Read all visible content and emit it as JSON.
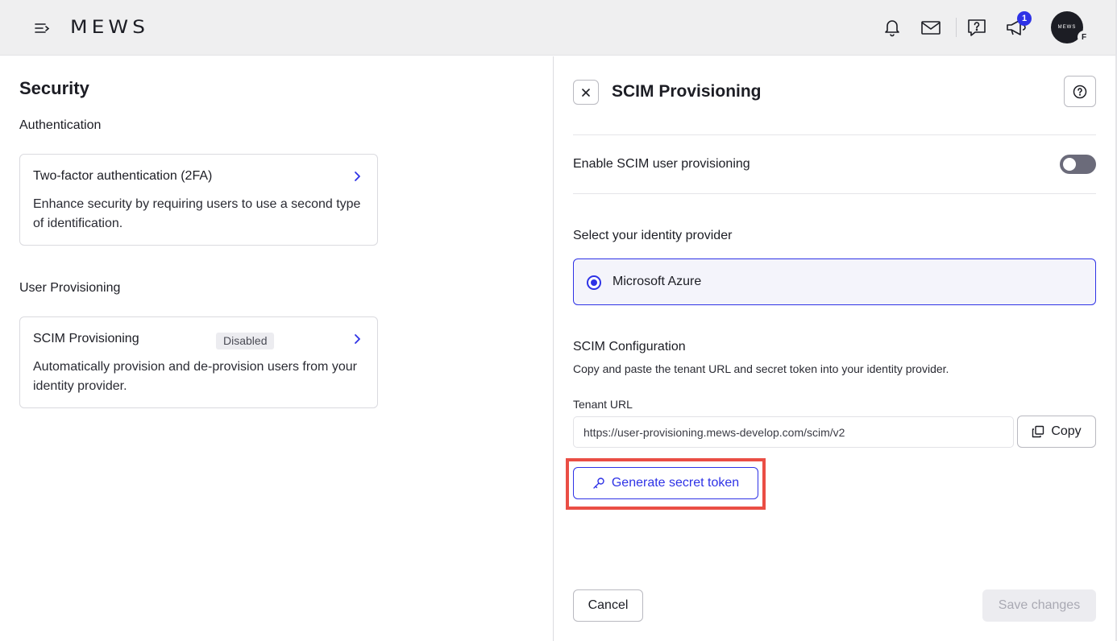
{
  "topbar": {
    "logo": "MEWS",
    "notification_count": "1",
    "avatar_text": "MEWS",
    "avatar_initial": "F",
    "icons": [
      "menu-icon",
      "bell-icon",
      "mail-icon",
      "help-chat-icon",
      "megaphone-icon"
    ]
  },
  "left": {
    "title": "Security",
    "authentication_section": "Authentication",
    "provisioning_section": "User Provisioning",
    "cards": [
      {
        "title": "Two-factor authentication (2FA)",
        "description": "Enhance security by requiring users to use a second type of identification."
      },
      {
        "title": "SCIM Provisioning",
        "badge": "Disabled",
        "description": "Automatically provision and de-provision users from your identity provider."
      }
    ]
  },
  "panel": {
    "title": "SCIM Provisioning",
    "toggle_label": "Enable SCIM user provisioning",
    "toggle_on": false,
    "select_provider_label": "Select your identity provider",
    "provider_option": "Microsoft Azure",
    "config_title": "SCIM Configuration",
    "config_description": "Copy and paste the tenant URL and secret token into your identity provider.",
    "tenant_url_label": "Tenant URL",
    "tenant_url_value": "https://user-provisioning.mews-develop.com/scim/v2",
    "copy_label": "Copy",
    "generate_token_label": "Generate secret token",
    "cancel_label": "Cancel",
    "save_label": "Save changes"
  },
  "colors": {
    "accent": "#2e32e6",
    "highlight": "#ea4e45",
    "topbar_bg": "#efeff0"
  }
}
